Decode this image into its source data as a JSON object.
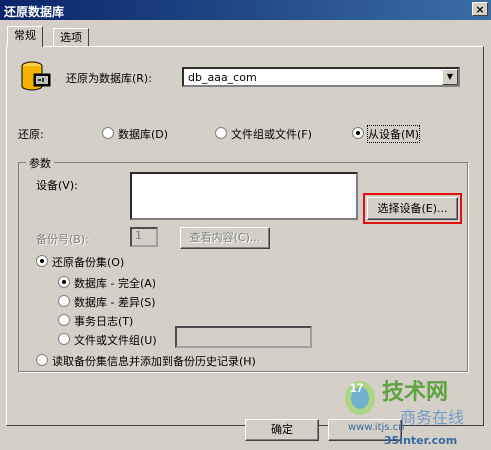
{
  "window": {
    "title": "还原数据库",
    "close_glyph": "×"
  },
  "tabs": [
    {
      "label": "常规"
    },
    {
      "label": "选项"
    }
  ],
  "restore_as": {
    "label": "还原为数据库(R):",
    "value": "db_aaa_com"
  },
  "restore_type": {
    "label": "还原:",
    "options": [
      "数据库(D)",
      "文件组或文件(F)",
      "从设备(M)"
    ],
    "selected": "从设备(M)"
  },
  "params": {
    "group_label": "参数",
    "device_label": "设备(V):",
    "select_device_button": "选择设备(E)...",
    "backup_no_label": "备份号(B):",
    "backup_no_value": "1",
    "view_contents_button": "查看内容(C)...",
    "restore_backup_set": "还原备份集(O)",
    "sub_options": [
      "数据库 - 完全(A)",
      "数据库 - 差异(S)",
      "事务日志(T)",
      "文件或文件组(U)"
    ],
    "sub_selected": "数据库 - 完全(A)",
    "read_history": "读取备份集信息并添加到备份历史记录(H)"
  },
  "buttons": {
    "ok": "确定"
  },
  "watermark": {
    "logo_text": "技术网",
    "sub": "商务在线",
    "url": "www.itjs.cn",
    "site": "35inter.com"
  },
  "colors": {
    "title_bar": "#0a246a",
    "highlight": "#e01010",
    "face": "#d4d0c8"
  }
}
